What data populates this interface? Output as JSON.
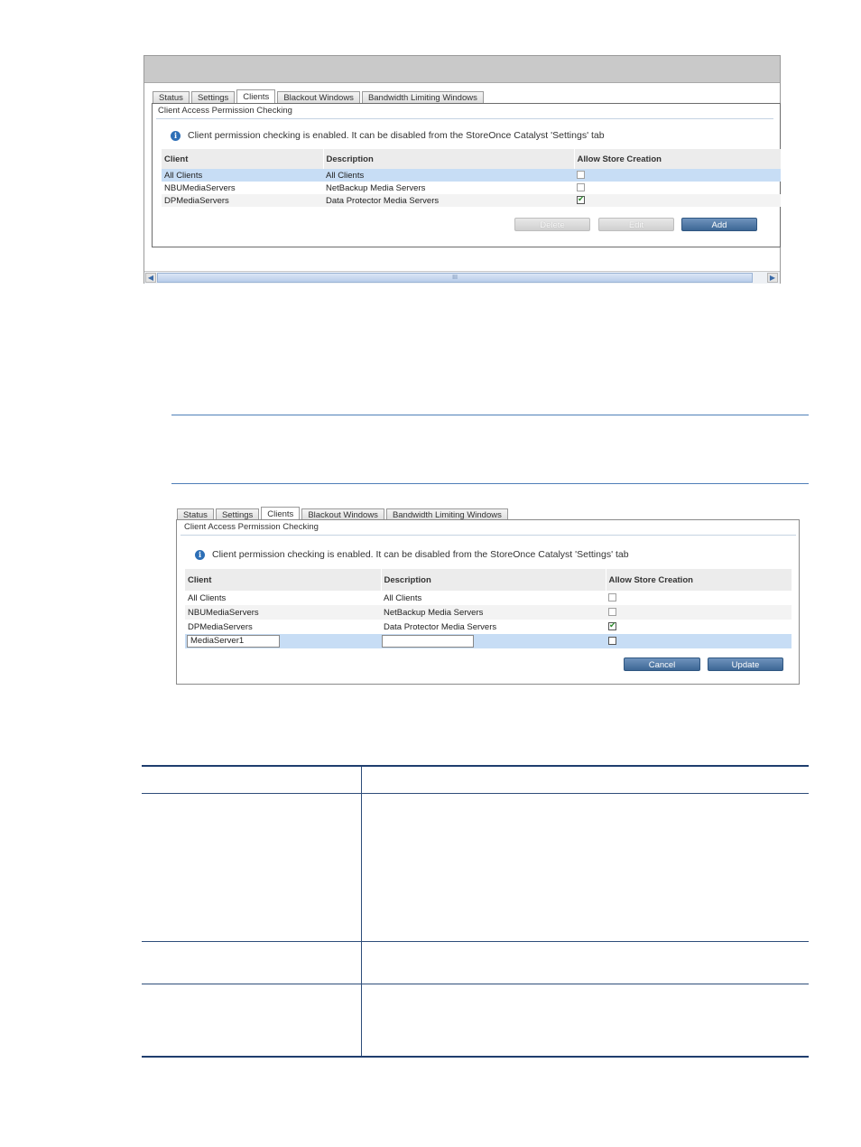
{
  "tabs": [
    "Status",
    "Settings",
    "Clients",
    "Blackout Windows",
    "Bandwidth Limiting Windows"
  ],
  "active_tab": "Clients",
  "section_title": "Client Access Permission Checking",
  "info_message": "Client permission checking is enabled. It can be disabled from the StoreOnce Catalyst 'Settings' tab",
  "columns": [
    "Client",
    "Description",
    "Allow Store Creation"
  ],
  "screen1": {
    "rows": [
      {
        "client": "All Clients",
        "description": "All Clients",
        "allow": false
      },
      {
        "client": "NBUMediaServers",
        "description": "NetBackup Media Servers",
        "allow": false
      },
      {
        "client": "DPMediaServers",
        "description": "Data Protector Media Servers",
        "allow": true
      }
    ],
    "buttons": {
      "delete": "Delete",
      "edit": "Edit",
      "add": "Add"
    },
    "scroll_thumb_grip": "III"
  },
  "screen2": {
    "rows": [
      {
        "client": "All Clients",
        "description": "All Clients",
        "allow": false
      },
      {
        "client": "NBUMediaServers",
        "description": "NetBackup Media Servers",
        "allow": false
      },
      {
        "client": "DPMediaServers",
        "description": "Data Protector Media Servers",
        "allow": true
      }
    ],
    "edit_row": {
      "client_value": "MediaServer1",
      "description_value": "",
      "allow": false
    },
    "buttons": {
      "cancel": "Cancel",
      "update": "Update"
    }
  },
  "colors": {
    "accent": "#3d6795",
    "selection": "#c7ddf5",
    "rule": "#4f7fb8",
    "table_border": "#1f3e6e"
  }
}
